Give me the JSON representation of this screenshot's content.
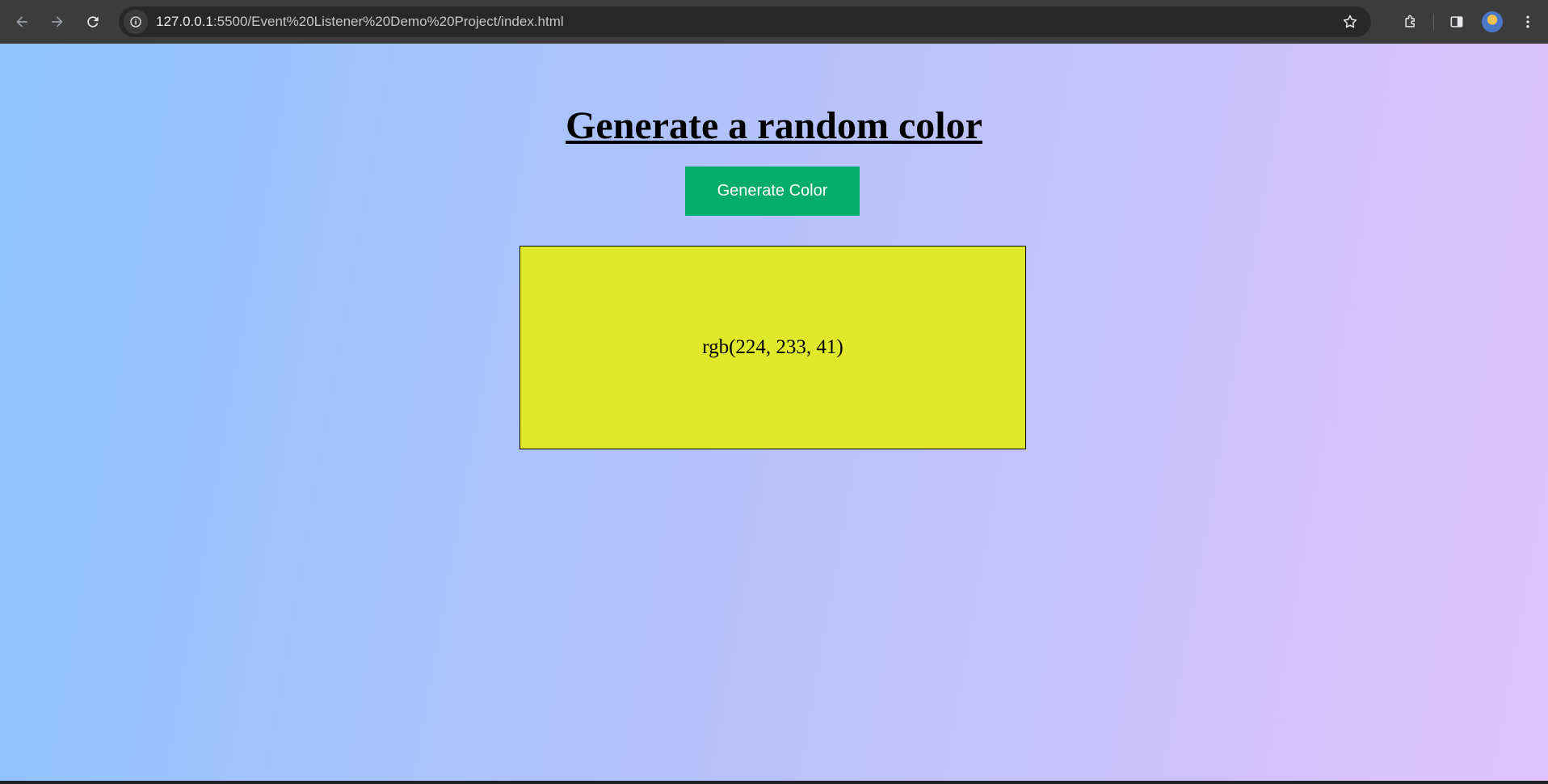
{
  "browser": {
    "url_host": "127.0.0.1",
    "url_path": ":5500/Event%20Listener%20Demo%20Project/index.html",
    "icons": [
      "back-arrow-icon",
      "forward-arrow-icon",
      "reload-icon",
      "site-info-icon",
      "bookmark-star-icon",
      "extensions-icon",
      "side-panel-icon",
      "profile-avatar",
      "more-menu-icon"
    ]
  },
  "page": {
    "title": "Generate a random color",
    "button_label": "Generate Color",
    "color_text": "rgb(224, 233, 41)",
    "color_hex": "#e0e929",
    "button_color": "#06ac6c",
    "background_gradient": [
      "#8ec5fc",
      "#e0c3fc"
    ]
  }
}
